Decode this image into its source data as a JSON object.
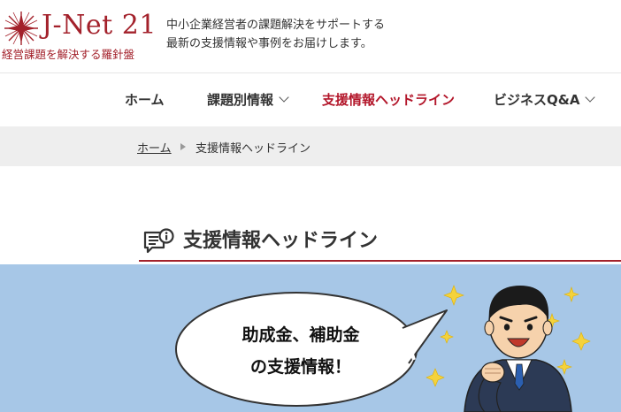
{
  "header": {
    "logo": {
      "name": "J-Net 21",
      "tagline": "経営課題を解決する羅針盤",
      "icon": "compass-star-icon",
      "color": "#a3212b"
    },
    "description": [
      "中小企業経営者の課題解決をサポートする",
      "最新の支援情報や事例をお届けします。"
    ]
  },
  "nav": {
    "items": [
      {
        "label": "ホーム",
        "has_dropdown": false,
        "active": false
      },
      {
        "label": "課題別情報",
        "has_dropdown": true,
        "active": false
      },
      {
        "label": "支援情報ヘッドライン",
        "has_dropdown": false,
        "active": true
      },
      {
        "label": "ビジネスQ&A",
        "has_dropdown": true,
        "active": false
      }
    ],
    "active_color": "#b3162a"
  },
  "breadcrumb": {
    "home": "ホーム",
    "current": "支援情報ヘッドライン"
  },
  "page": {
    "title": "支援情報ヘッドライン",
    "title_icon": "info-board-icon"
  },
  "banner": {
    "lines": [
      "助成金、補助金",
      "の支援情報！"
    ],
    "background": "#a7c7e7",
    "illustration": "businessman-fist-pump"
  }
}
